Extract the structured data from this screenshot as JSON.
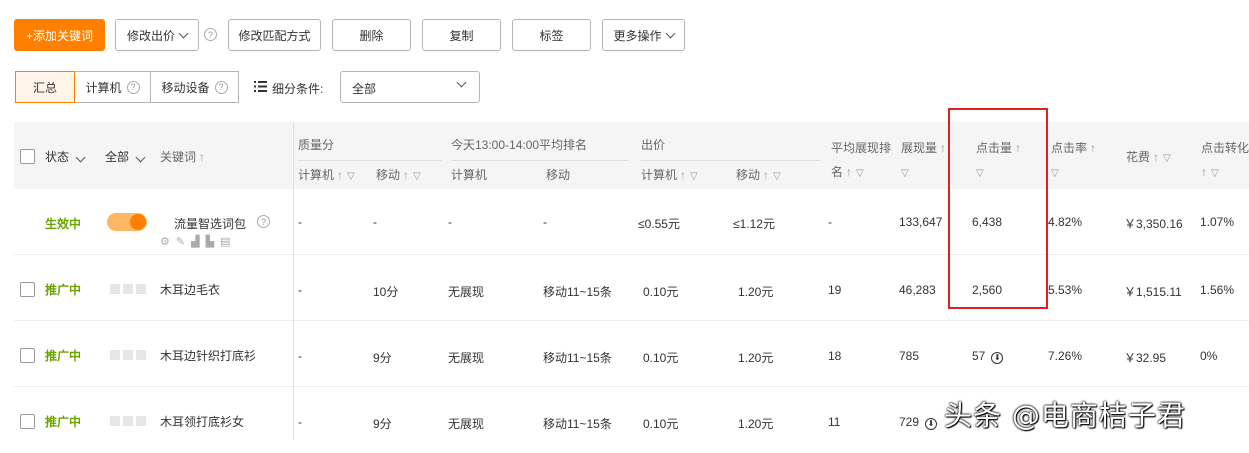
{
  "toolbar": {
    "add_keyword": "+添加关键词",
    "modify_bid": "修改出价",
    "modify_match": "修改匹配方式",
    "delete": "删除",
    "copy": "复制",
    "tag": "标签",
    "more_actions": "更多操作"
  },
  "device_tabs": {
    "summary": "汇总",
    "computer": "计算机",
    "mobile": "移动设备"
  },
  "filter": {
    "label": "细分条件:",
    "value": "全部"
  },
  "table": {
    "headers": {
      "status": "状态",
      "all": "全部",
      "keyword": "关键词",
      "quality": "质量分",
      "quality_pc": "计算机",
      "quality_mobile": "移动",
      "rank_group": "今天13:00-14:00平均排名",
      "rank_pc": "计算机",
      "rank_mobile": "移动",
      "bid": "出价",
      "bid_pc": "计算机",
      "bid_mobile": "移动",
      "avg_rank_line1": "平均展现排",
      "avg_rank_line2": "名",
      "impressions": "展现量",
      "clicks": "点击量",
      "ctr": "点击率",
      "cost": "花费",
      "conv_line1": "点击转化",
      "sort_arrow": "↑"
    },
    "rows": [
      {
        "status": "生效中",
        "keyword": "流量智选词包",
        "quality_pc": "-",
        "quality_mobile": "-",
        "rank_pc": "-",
        "rank_mobile": "-",
        "bid_pc": "≤0.55元",
        "bid_mobile": "≤1.12元",
        "avg_rank": "-",
        "impressions": "133,647",
        "clicks": "6,438",
        "ctr": "4.82%",
        "cost": "￥3,350.16",
        "conv": "1.07%"
      },
      {
        "status": "推广中",
        "keyword": "木耳边毛衣",
        "quality_pc": "-",
        "quality_mobile": "10分",
        "rank_pc": "无展现",
        "rank_mobile": "移动11~15条",
        "bid_pc": "0.10元",
        "bid_mobile": "1.20元",
        "avg_rank": "19",
        "impressions": "46,283",
        "clicks": "2,560",
        "ctr": "5.53%",
        "cost": "￥1,515.11",
        "conv": "1.56%"
      },
      {
        "status": "推广中",
        "keyword": "木耳边针织打底衫",
        "quality_pc": "-",
        "quality_mobile": "9分",
        "rank_pc": "无展现",
        "rank_mobile": "移动11~15条",
        "bid_pc": "0.10元",
        "bid_mobile": "1.20元",
        "avg_rank": "18",
        "impressions": "785",
        "clicks": "57",
        "ctr": "7.26%",
        "cost": "￥32.95",
        "conv": "0%"
      },
      {
        "status": "推广中",
        "keyword": "木耳领打底衫女",
        "quality_pc": "-",
        "quality_mobile": "9分",
        "rank_pc": "无展现",
        "rank_mobile": "移动11~15条",
        "bid_pc": "0.10元",
        "bid_mobile": "1.20元",
        "avg_rank": "11",
        "impressions": "729",
        "clicks": "",
        "ctr": "",
        "cost": "",
        "conv": ""
      }
    ]
  },
  "watermark": "头条 @电商桔子君",
  "colors": {
    "accent": "#ff8000",
    "status_green": "#6ba300",
    "highlight_border": "#e02020"
  }
}
